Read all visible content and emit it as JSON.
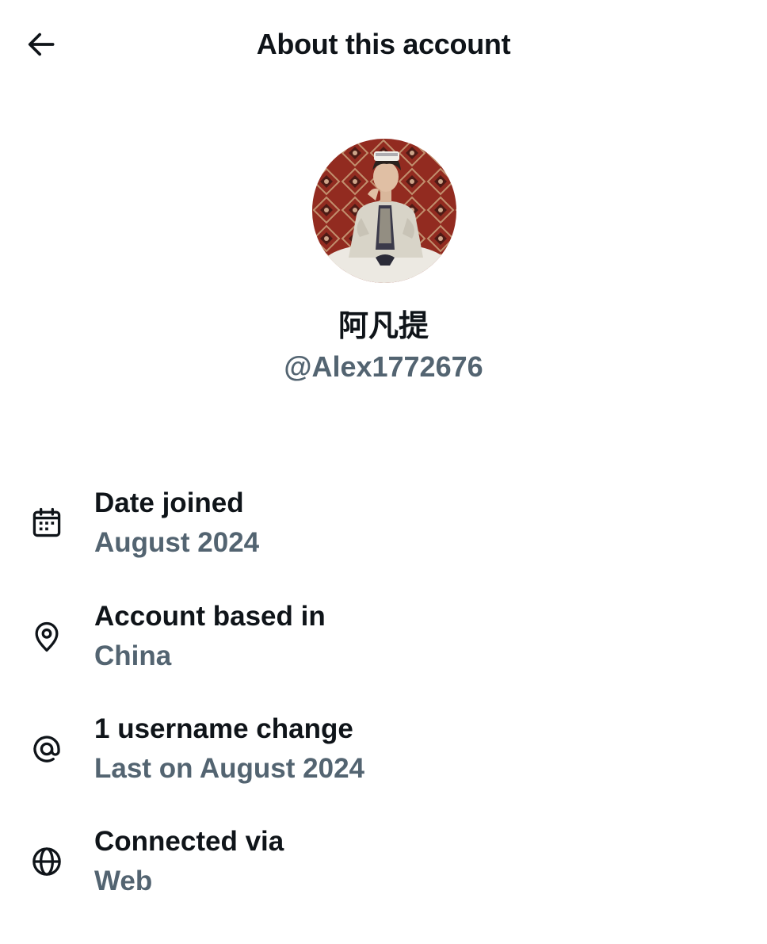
{
  "header": {
    "title": "About this account",
    "back_icon": "arrow-left-icon"
  },
  "profile": {
    "display_name": "阿凡提",
    "handle": "@Alex1772676"
  },
  "details": [
    {
      "icon": "calendar-icon",
      "label": "Date joined",
      "value": "August 2024"
    },
    {
      "icon": "location-pin-icon",
      "label": "Account based in",
      "value": "China"
    },
    {
      "icon": "at-sign-icon",
      "label": "1 username change",
      "value": "Last on August 2024"
    },
    {
      "icon": "globe-icon",
      "label": "Connected via",
      "value": "Web"
    }
  ],
  "colors": {
    "text_primary": "#0f1419",
    "text_secondary": "#536471",
    "background": "#ffffff"
  }
}
